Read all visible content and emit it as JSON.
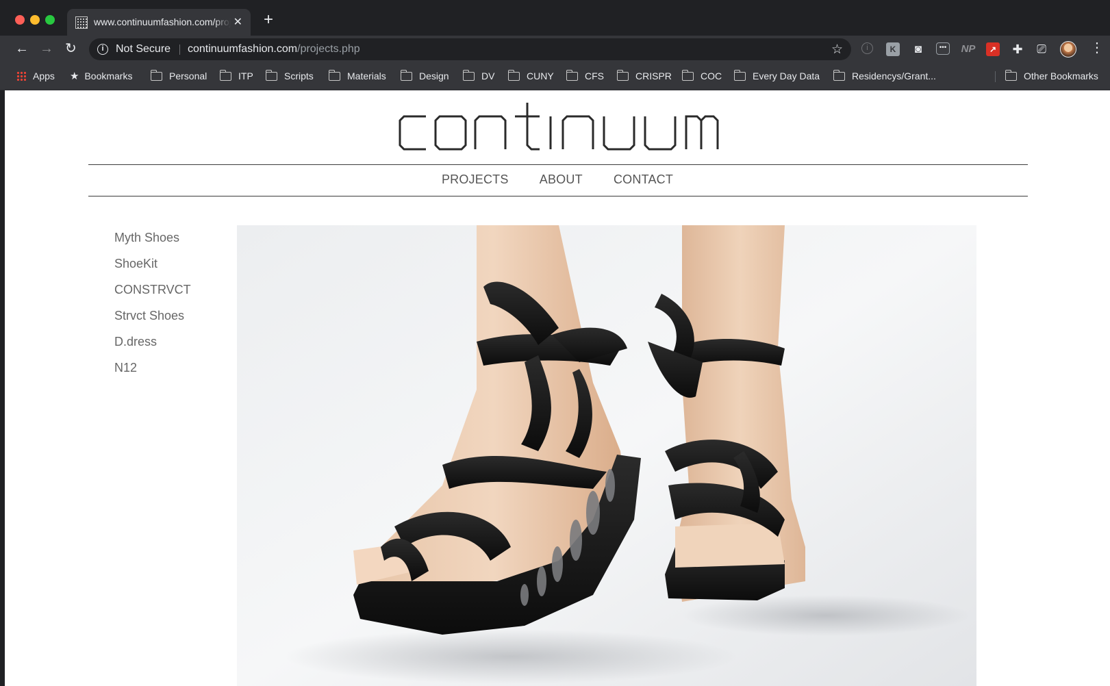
{
  "browser": {
    "tab_title": "www.continuumfashion.com/projects.php",
    "new_tab_symbol": "+",
    "close_symbol": "✕",
    "omnibox": {
      "security_label": "Not Secure",
      "url_host": "continuumfashion.com",
      "url_path": "/projects.php"
    },
    "extensions": {
      "e1": "i",
      "e2": "K",
      "e4": "•••",
      "e5": "NP",
      "e6": "↗"
    }
  },
  "bookmarks": {
    "apps": "Apps",
    "bookmarks": "Bookmarks",
    "folders": [
      "Personal",
      "ITP",
      "Scripts",
      "Materials",
      "Design",
      "DV",
      "CUNY",
      "CFS",
      "CRISPR",
      "COC",
      "Every Day Data",
      "Residencys/Grant..."
    ],
    "other": "Other Bookmarks"
  },
  "site": {
    "logo_text": "continuum",
    "nav": {
      "projects": "PROJECTS",
      "about": "ABOUT",
      "contact": "CONTACT"
    },
    "projects_list": [
      "Myth Shoes",
      "ShoeKit",
      "CONSTRVCT",
      "Strvct Shoes",
      "D.dress",
      "N12"
    ]
  }
}
